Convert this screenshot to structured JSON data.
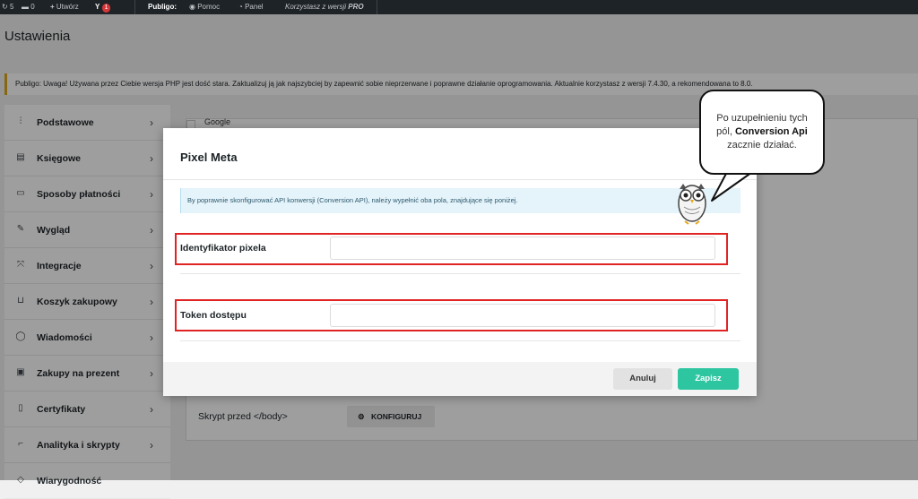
{
  "admin_bar": {
    "updates_count": "5",
    "comments_count": "0",
    "new_label": "Utwórz",
    "yoast_badge": "1",
    "brand": "Publigo:",
    "help_label": "Pomoc",
    "panel_label": "Panel",
    "version_prefix": "Korzystasz z wersji",
    "version_name": "PRO"
  },
  "page": {
    "title": "Ustawienia",
    "notice": "Publigo: Uwaga! Używana przez Ciebie wersja PHP jest dość stara. Zaktualizuj ją jak najszybciej by zapewnić sobie nieprzerwane i poprawne działanie oprogramowania. Aktualnie korzystasz z wersji 7.4.30, a rekomendowana to 8.0."
  },
  "sidebar": {
    "items": [
      {
        "label": "Podstawowe",
        "icon": "sliders-icon"
      },
      {
        "label": "Księgowe",
        "icon": "document-icon"
      },
      {
        "label": "Sposoby płatności",
        "icon": "card-icon"
      },
      {
        "label": "Wygląd",
        "icon": "brush-icon"
      },
      {
        "label": "Integracje",
        "icon": "plug-icon"
      },
      {
        "label": "Koszyk zakupowy",
        "icon": "cart-icon"
      },
      {
        "label": "Wiadomości",
        "icon": "chat-icon"
      },
      {
        "label": "Zakupy na prezent",
        "icon": "gift-icon"
      },
      {
        "label": "Certyfikaty",
        "icon": "certificate-icon"
      },
      {
        "label": "Analityka i skrypty",
        "icon": "chart-icon"
      },
      {
        "label": "Wiarygodność",
        "icon": "shield-icon"
      }
    ]
  },
  "content": {
    "google_label": "Google",
    "script_label": "Skrypt przed </body>",
    "configure_label": "KONFIGURUJ"
  },
  "modal": {
    "title": "Pixel Meta",
    "info": "By poprawnie skonfigurować API konwersji (Conversion API), należy wypełnić oba pola, znajdujące się poniżej.",
    "fields": [
      {
        "label": "Identyfikator pixela",
        "value": ""
      },
      {
        "label": "Token dostępu",
        "value": ""
      }
    ],
    "cancel_label": "Anuluj",
    "save_label": "Zapisz"
  },
  "callout": {
    "line1": "Po uzupełnieniu tych",
    "line2_prefix": "pól,",
    "line2_bold": "Conversion Api",
    "line3": "zacznie działać."
  },
  "colors": {
    "accent": "#2ec5a1",
    "highlight": "#e02424",
    "admin_bar": "#1d2327"
  }
}
